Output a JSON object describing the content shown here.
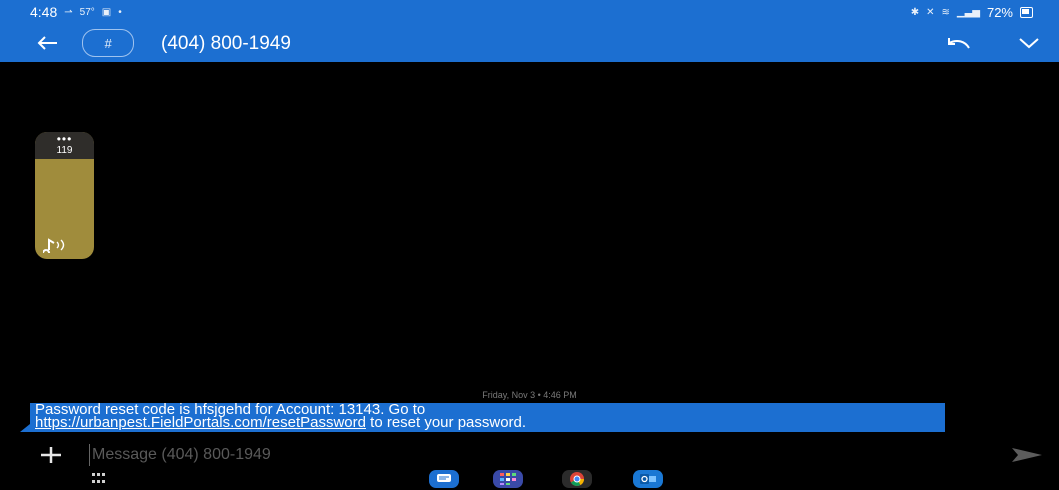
{
  "status_bar": {
    "time": "4:48",
    "weather": "57°",
    "battery": "72%",
    "icons": [
      "signal-icon",
      "weather-icon",
      "notification-icon",
      "bluetooth-icon",
      "mute-icon",
      "wifi-icon",
      "cell-signal-icon",
      "battery-icon"
    ]
  },
  "app_bar": {
    "avatar_symbol": "#",
    "contact": "(404) 800-1949"
  },
  "side_widget": {
    "count": "119"
  },
  "conversation": {
    "date_label": "Friday, Nov 3 • 4:46 PM",
    "message": {
      "line1": "Password reset code is hfsjgehd for Account: 13143. Go to",
      "link": "https://urbanpest.FieldPortals.com/resetPassword",
      "line2_suffix": " to reset your password."
    }
  },
  "composer": {
    "placeholder": "Message (404) 800-1949"
  },
  "dock": {
    "apps": [
      "messages-app",
      "apps-folder",
      "chrome-app",
      "outlook-app"
    ]
  },
  "colors": {
    "accent": "#1c6fd1",
    "background": "#000000",
    "widget": "#a08c3c"
  }
}
